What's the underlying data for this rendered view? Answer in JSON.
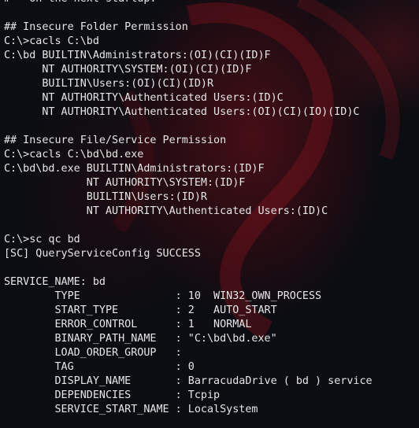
{
  "terminal": {
    "lines": [
      "#   on the next startup.",
      "",
      "## Insecure Folder Permission",
      "C:\\>cacls C:\\bd",
      "C:\\bd BUILTIN\\Administrators:(OI)(CI)(ID)F",
      "      NT AUTHORITY\\SYSTEM:(OI)(CI)(ID)F",
      "      BUILTIN\\Users:(OI)(CI)(ID)R",
      "      NT AUTHORITY\\Authenticated Users:(ID)C",
      "      NT AUTHORITY\\Authenticated Users:(OI)(CI)(IO)(ID)C",
      "",
      "## Insecure File/Service Permission",
      "C:\\>cacls C:\\bd\\bd.exe",
      "C:\\bd\\bd.exe BUILTIN\\Administrators:(ID)F",
      "             NT AUTHORITY\\SYSTEM:(ID)F",
      "             BUILTIN\\Users:(ID)R",
      "             NT AUTHORITY\\Authenticated Users:(ID)C",
      "",
      "C:\\>sc qc bd",
      "[SC] QueryServiceConfig SUCCESS",
      "",
      "SERVICE_NAME: bd",
      "        TYPE               : 10  WIN32_OWN_PROCESS",
      "        START_TYPE         : 2   AUTO_START",
      "        ERROR_CONTROL      : 1   NORMAL",
      "        BINARY_PATH_NAME   : \"C:\\bd\\bd.exe\"",
      "        LOAD_ORDER_GROUP   :",
      "        TAG                : 0",
      "        DISPLAY_NAME       : BarracudaDrive ( bd ) service",
      "        DEPENDENCIES       : Tcpip",
      "        SERVICE_START_NAME : LocalSystem",
      ""
    ]
  },
  "colors": {
    "text": "#e6e6e6",
    "background": "#0b0d12",
    "wallpaper_accent": "#7a0e18"
  }
}
